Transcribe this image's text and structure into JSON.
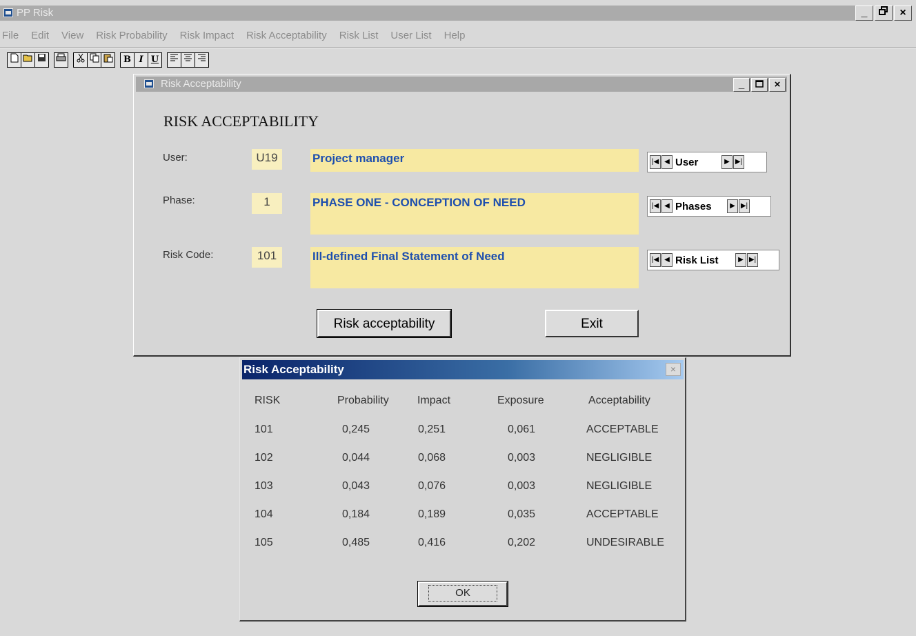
{
  "app": {
    "title": "PP Risk"
  },
  "window_buttons": [
    "_",
    "&#8203;",
    "×"
  ],
  "menu": [
    "File",
    "Edit",
    "View",
    "Risk Probability",
    "Risk Impact",
    "Risk Acceptability",
    "Risk List",
    "User List",
    "Help"
  ],
  "toolbar": {
    "groups": [
      [
        "new-icon",
        "open-icon",
        "save-icon"
      ],
      [
        "print-icon"
      ],
      [
        "cut-icon",
        "copy-icon",
        "paste-icon"
      ],
      [
        "bold-icon",
        "italic-icon",
        "underline-icon"
      ],
      [
        "align-left-icon",
        "align-center-icon",
        "align-right-icon"
      ]
    ],
    "format_labels": {
      "bold": "B",
      "italic": "I",
      "underline": "U"
    }
  },
  "form": {
    "window_title": "Risk Acceptability",
    "heading": "RISK ACCEPTABILITY",
    "user": {
      "label": "User:",
      "code": "U19",
      "description": "Project manager",
      "nav_label": "User"
    },
    "phase": {
      "label": "Phase:",
      "code": "1",
      "description": "PHASE ONE - CONCEPTION OF NEED",
      "nav_label": "Phases"
    },
    "risk": {
      "label": "Risk Code:",
      "code": "101",
      "description": "Ill-defined Final Statement of Need",
      "nav_label": "Risk List"
    },
    "buttons": {
      "risk_acceptability": "Risk acceptability",
      "exit": "Exit"
    }
  },
  "dialog": {
    "title": "Risk Acceptability",
    "close": "×",
    "columns": [
      "RISK",
      "Probability",
      "Impact",
      "Exposure",
      "Acceptability"
    ],
    "rows": [
      [
        "101",
        "0,245",
        "0,251",
        "0,061",
        "ACCEPTABLE"
      ],
      [
        "102",
        "0,044",
        "0,068",
        "0,003",
        "NEGLIGIBLE"
      ],
      [
        "103",
        "0,043",
        "0,076",
        "0,003",
        "NEGLIGIBLE"
      ],
      [
        "104",
        "0,184",
        "0,189",
        "0,035",
        "ACCEPTABLE"
      ],
      [
        "105",
        "0,485",
        "0,416",
        "0,202",
        "UNDESIRABLE"
      ]
    ],
    "ok": "OK"
  }
}
